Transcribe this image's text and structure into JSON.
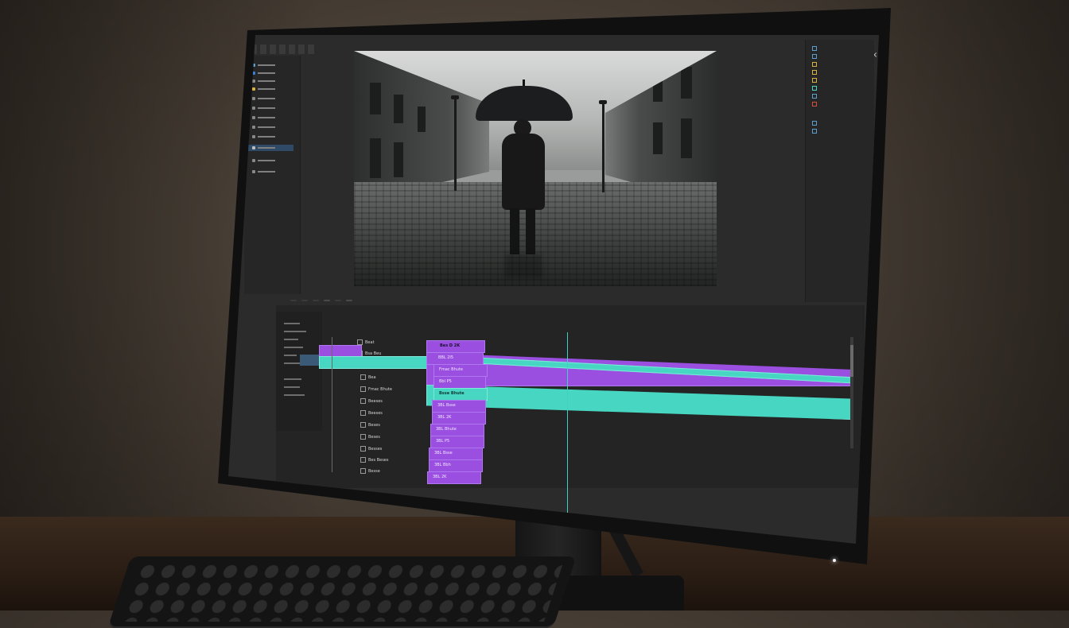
{
  "app": {
    "menu": [
      "",
      "",
      "",
      "",
      "",
      "",
      ""
    ],
    "close_glyph": "×"
  },
  "preview": {
    "caption": ""
  },
  "right_panel": {
    "items": [
      "",
      "",
      "",
      "",
      "",
      "",
      "",
      "",
      "",
      ""
    ]
  },
  "transport": {
    "buttons": [
      "",
      "",
      "",
      "",
      "",
      ""
    ]
  },
  "timeline": {
    "ruler": [
      "",
      "",
      "",
      "",
      "",
      "",
      "",
      "",
      ""
    ],
    "tracks": [
      {
        "label": "Beat"
      },
      {
        "label": "Bsa Beu"
      },
      {
        "label": ""
      },
      {
        "label": "Bea"
      },
      {
        "label": "Fmac Bhute"
      },
      {
        "label": "Beeses"
      },
      {
        "label": "Beeses"
      },
      {
        "label": "Beses"
      },
      {
        "label": "Beses"
      },
      {
        "label": "Besses"
      },
      {
        "label": "Bes Beses"
      },
      {
        "label": "Besse"
      }
    ],
    "clips_purple": [
      "Bes D 2K",
      "BBL 2I5",
      "Fmac Bhute",
      "Bbl P5",
      "Bsse Bhute",
      "3BL Bsse",
      "3BL 2K",
      "3BL Bhute",
      "3BL P5",
      "3BL Bsse",
      "3BL Bbh",
      "3BL 2K"
    ],
    "clips_teal": [
      "",
      ""
    ]
  },
  "status": {
    "right": ""
  },
  "colors": {
    "accent_purple": "#9b4fe0",
    "accent_teal": "#46d6c2",
    "panel_bg": "#2b2b2b"
  }
}
